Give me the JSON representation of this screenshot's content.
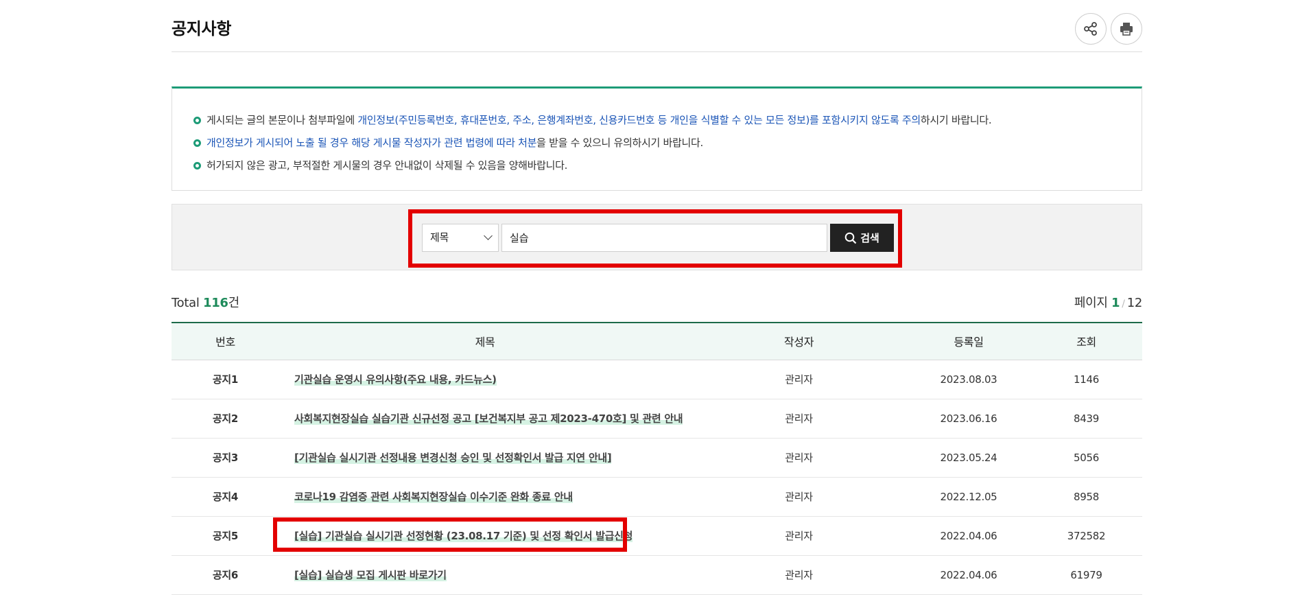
{
  "header": {
    "title": "공지사항",
    "share_icon": "share-icon",
    "print_icon": "print-icon"
  },
  "notice": [
    {
      "parts": [
        {
          "t": "게시되는 글의 본문이나 첨부파일에 ",
          "blue": false
        },
        {
          "t": "개인정보(주민등록번호, 휴대폰번호, 주소, 은행계좌번호, 신용카드번호 등 개인을 식별할 수 있는 모든 정보)를 포함시키지 않도록 주의",
          "blue": true
        },
        {
          "t": "하시기 바랍니다.",
          "blue": false
        }
      ]
    },
    {
      "parts": [
        {
          "t": "개인정보가 게시되어 노출 될 경우 해당 게시물 작성자가 관련 법령에 따라 처분",
          "blue": true
        },
        {
          "t": "을 받을 수 있으니 유의하시기 바랍니다.",
          "blue": false
        }
      ]
    },
    {
      "parts": [
        {
          "t": "허가되지 않은 광고, 부적절한 게시물의 경우 안내없이 삭제될 수 있음을 양해바랍니다.",
          "blue": false
        }
      ]
    }
  ],
  "search": {
    "select_value": "제목",
    "input_value": "실습",
    "button_label": "검색"
  },
  "total": {
    "label": "Total ",
    "count": "116",
    "unit": "건"
  },
  "page": {
    "label": "페이지 ",
    "current": "1",
    "total": "12"
  },
  "table": {
    "headers": [
      "번호",
      "제목",
      "작성자",
      "등록일",
      "조회"
    ],
    "rows": [
      {
        "num": "공지1",
        "title": "기관실습 운영시 유의사항(주요 내용, 카드뉴스)",
        "author": "관리자",
        "date": "2023.08.03",
        "views": "1146"
      },
      {
        "num": "공지2",
        "title": "사회복지현장실습 실습기관 신규선정 공고 [보건복지부 공고 제2023-470호] 및 관련 안내",
        "author": "관리자",
        "date": "2023.06.16",
        "views": "8439"
      },
      {
        "num": "공지3",
        "title": "[기관실습 실시기관 선정내용 변경신청 승인 및 선정확인서 발급 지연 안내]",
        "author": "관리자",
        "date": "2023.05.24",
        "views": "5056"
      },
      {
        "num": "공지4",
        "title": "코로나19 감염증 관련 사회복지현장실습 이수기준 완화 종료 안내",
        "author": "관리자",
        "date": "2022.12.05",
        "views": "8958"
      },
      {
        "num": "공지5",
        "title": "[실습] 기관실습 실시기관 선정현황 (23.08.17 기준) 및 선정 확인서 발급신청",
        "author": "관리자",
        "date": "2022.04.06",
        "views": "372582"
      },
      {
        "num": "공지6",
        "title": "[실습] 실습생 모집 게시판 바로가기",
        "author": "관리자",
        "date": "2022.04.06",
        "views": "61979"
      }
    ]
  },
  "colors": {
    "accent_green": "#1d9b77",
    "highlight_red": "#e30000",
    "notice_blue": "#1c56b7"
  }
}
